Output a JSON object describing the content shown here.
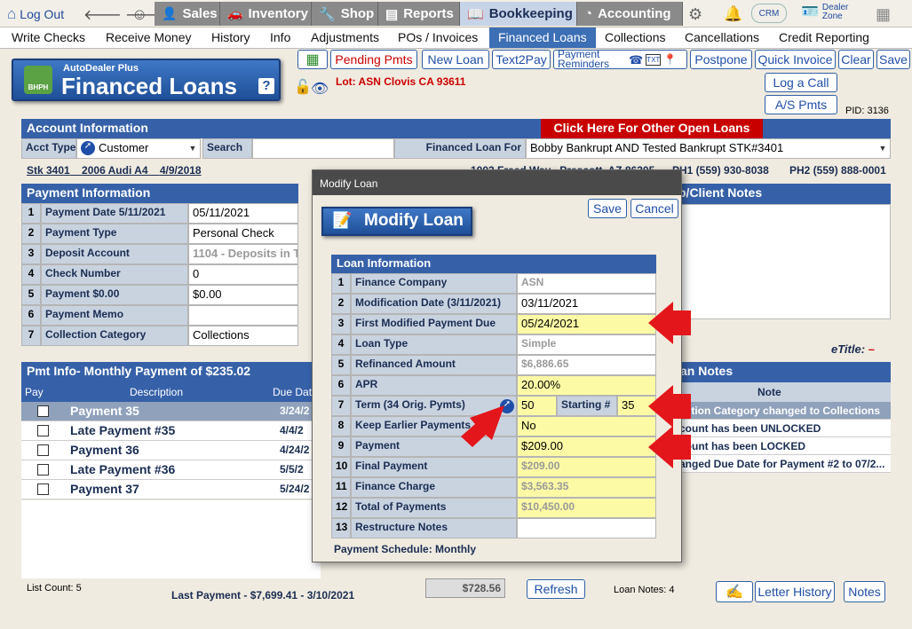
{
  "topbar": {
    "logout": "Log Out",
    "tabs": [
      "Sales",
      "Inventory",
      "Shop",
      "Reports",
      "Bookkeeping",
      "Accounting"
    ],
    "crm": "CRM",
    "dealer_zone": "Dealer Zone"
  },
  "menu": [
    "Write Checks",
    "Receive Money",
    "History",
    "Info",
    "Adjustments",
    "POs / Invoices",
    "Financed Loans",
    "Collections",
    "Cancellations",
    "Credit Reporting"
  ],
  "logo": {
    "small": "AutoDealer Plus",
    "big": "Financed Loans",
    "badge": "BHPH",
    "help": "?"
  },
  "toolbar": {
    "pending": "Pending Pmts",
    "new_loan": "New Loan",
    "text2pay": "Text2Pay",
    "payment_reminders": "Payment Reminders",
    "postpone": "Postpone",
    "quick_invoice": "Quick Invoice",
    "clear": "Clear",
    "save": "Save",
    "log_call": "Log a Call",
    "as_pmts": "A/S Pmts",
    "pid": "PID: 3136"
  },
  "lot": "Lot: ASN Clovis CA 93611",
  "account": {
    "header": "Account Information",
    "other_loans": "Click Here For Other Open Loans",
    "acct_type_label": "Acct Type",
    "acct_type": "Customer",
    "search_label": "Search",
    "search_value": "",
    "loan_for_label": "Financed Loan For",
    "loan_for": "Bobby Bankrupt AND Tested Bankrupt STK#3401",
    "stk": "Stk 3401",
    "vehicle": "2006 Audi A4",
    "date": "4/9/2018",
    "address": "1003 Freed Way",
    "city": "Prescott, AZ 86305",
    "ph1": "PH1 (559) 930-8038",
    "ph2": "PH2 (559) 888-0001"
  },
  "payment": {
    "header": "Payment Information",
    "rows": [
      {
        "n": "1",
        "label": "Payment Date 5/11/2021",
        "value": "05/11/2021"
      },
      {
        "n": "2",
        "label": "Payment Type",
        "value": "Personal Check"
      },
      {
        "n": "3",
        "label": "Deposit Account",
        "value": "1104 - Deposits in T"
      },
      {
        "n": "4",
        "label": "Check Number",
        "value": "0"
      },
      {
        "n": "5",
        "label": "Payment $0.00",
        "value": "$0.00"
      },
      {
        "n": "6",
        "label": "Payment Memo",
        "value": ""
      },
      {
        "n": "7",
        "label": "Collection Category",
        "value": "Collections"
      }
    ]
  },
  "pmtinfo": {
    "header": "Pmt Info- Monthly Payment of $235.02",
    "cols": [
      "Pay",
      "Description",
      "Due Dat"
    ],
    "rows": [
      {
        "desc": "Payment 35",
        "due": "3/24/2"
      },
      {
        "desc": "Late Payment #35",
        "due": "4/4/2"
      },
      {
        "desc": "Payment 36",
        "due": "4/24/2"
      },
      {
        "desc": "Late Payment #36",
        "due": "5/5/2"
      },
      {
        "desc": "Payment 37",
        "due": "5/24/2"
      }
    ],
    "list_count": "List Count: 5",
    "last_payment": "Last Payment - $7,699.41 - 3/10/2021",
    "total": "$728.56",
    "refresh": "Refresh"
  },
  "client_notes": {
    "header": "p/Client Notes"
  },
  "etitle": {
    "label": "eTitle:",
    "value": "–"
  },
  "loan_notes": {
    "header": "an Notes",
    "col": "Note",
    "rows": [
      "ection Category changed to Collections",
      "count has been UNLOCKED",
      "count has been LOCKED",
      "anged Due Date for Payment #2 to 07/2..."
    ],
    "count": "Loan Notes: 4",
    "letter_history": "Letter History",
    "notes": "Notes"
  },
  "modal": {
    "title": "Modify Loan",
    "banner": "Modify Loan",
    "save": "Save",
    "cancel": "Cancel",
    "section": "Loan Information",
    "schedule": "Payment Schedule: Monthly",
    "rows": [
      {
        "n": "1",
        "label": "Finance Company",
        "value": "ASN"
      },
      {
        "n": "2",
        "label": "Modification Date (3/11/2021)",
        "value": "03/11/2021"
      },
      {
        "n": "3",
        "label": "First Modified Payment Due",
        "value": "05/24/2021"
      },
      {
        "n": "4",
        "label": "Loan Type",
        "value": "Simple"
      },
      {
        "n": "5",
        "label": "Refinanced Amount",
        "value": "$6,886.65"
      },
      {
        "n": "6",
        "label": "APR",
        "value": "20.00%"
      },
      {
        "n": "7",
        "label": "Term  (34 Orig. Pymts)",
        "value": "50",
        "extra_label": "Starting #",
        "extra_value": "35"
      },
      {
        "n": "8",
        "label": "Keep Earlier Payments",
        "value": "No"
      },
      {
        "n": "9",
        "label": "Payment",
        "value": "$209.00"
      },
      {
        "n": "10",
        "label": "Final Payment",
        "value": "$209.00"
      },
      {
        "n": "11",
        "label": "Finance Charge",
        "value": "$3,563.35"
      },
      {
        "n": "12",
        "label": "Total of Payments",
        "value": "$10,450.00"
      },
      {
        "n": "13",
        "label": "Restructure Notes",
        "value": ""
      }
    ]
  }
}
